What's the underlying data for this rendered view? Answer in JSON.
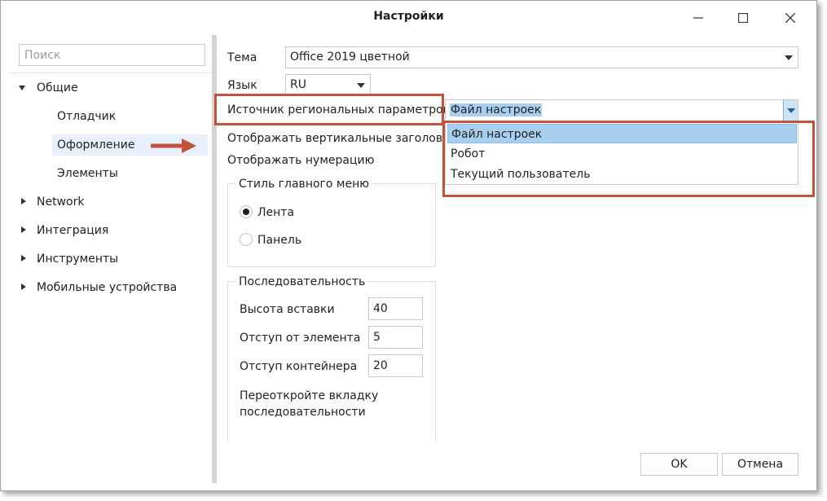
{
  "window": {
    "title": "Настройки"
  },
  "sidebar": {
    "search_placeholder": "Поиск",
    "items": [
      {
        "label": "Общие"
      },
      {
        "label": "Отладчик"
      },
      {
        "label": "Оформление"
      },
      {
        "label": "Элементы"
      },
      {
        "label": "Network"
      },
      {
        "label": "Интеграция"
      },
      {
        "label": "Инструменты"
      },
      {
        "label": "Мобильные устройства"
      }
    ]
  },
  "settings": {
    "theme": {
      "label": "Тема",
      "value": "Office 2019 цветной"
    },
    "language": {
      "label": "Язык",
      "value": "RU"
    },
    "regional_source": {
      "label": "Источник региональных параметров",
      "value": "Файл настроек",
      "options": [
        "Файл настроек",
        "Робот",
        "Текущий пользователь"
      ]
    },
    "show_vertical_headers": "Отображать вертикальные заголовки",
    "show_numbering": "Отображать нумерацию",
    "main_menu_style": {
      "title": "Стиль главного меню",
      "options": [
        "Лента",
        "Панель"
      ],
      "selected": "Лента"
    },
    "sequence": {
      "title": "Последовательность",
      "insert_height": {
        "label": "Высота вставки",
        "value": "40"
      },
      "element_offset": {
        "label": "Отступ от элемента",
        "value": "5"
      },
      "container_offset": {
        "label": "Отступ контейнера",
        "value": "20"
      },
      "note": "Переоткройте вкладку последовательности"
    }
  },
  "buttons": {
    "ok": "OK",
    "cancel": "Отмена"
  },
  "colors": {
    "highlight": "#c0533a",
    "selection": "#a9cff0"
  }
}
